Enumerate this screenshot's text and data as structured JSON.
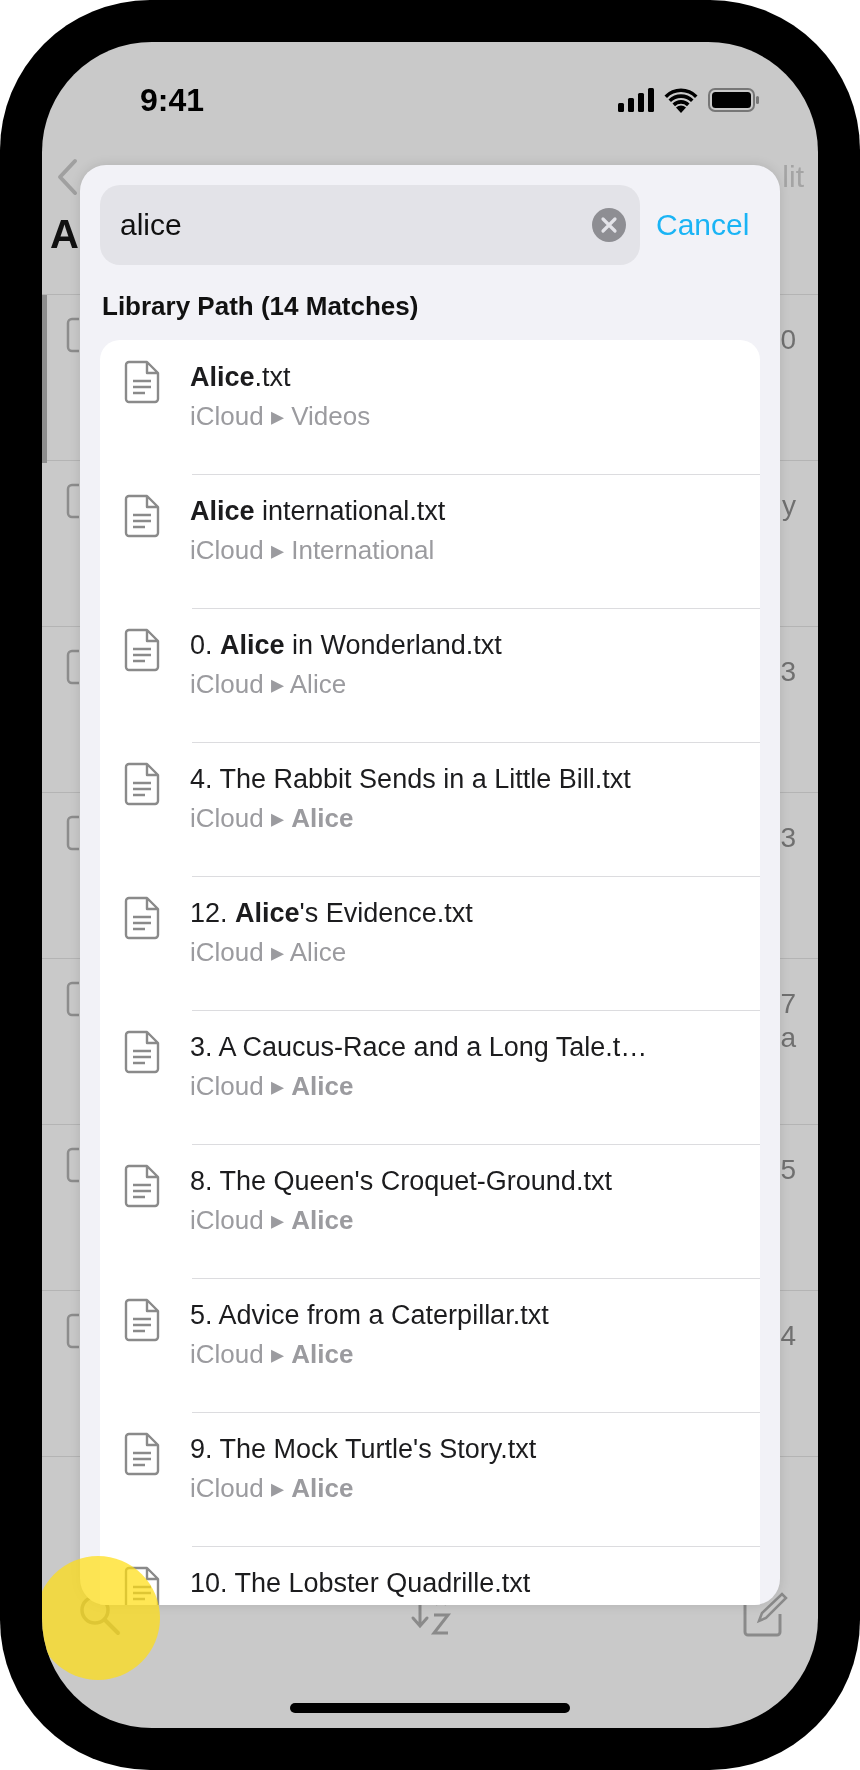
{
  "status_bar": {
    "time": "9:41"
  },
  "background": {
    "nav_fragment": "lit",
    "title_fragment": "A",
    "rows": [
      {
        "tail": [
          "0"
        ]
      },
      {
        "tail": [
          "y"
        ]
      },
      {
        "tail": [
          "3"
        ]
      },
      {
        "tail": [
          "3"
        ]
      },
      {
        "tail": [
          "7",
          "a"
        ]
      },
      {
        "tail": [
          "5"
        ]
      },
      {
        "tail": [
          "4"
        ]
      }
    ]
  },
  "search": {
    "value": "alice",
    "cancel": "Cancel"
  },
  "results": {
    "header": "Library Path (14 Matches)",
    "items": [
      {
        "title": "**Alice**.txt",
        "path": "iCloud ▸ Videos"
      },
      {
        "title": "**Alice** international.txt",
        "path": "iCloud ▸ International"
      },
      {
        "title": "0. **Alice** in Wonderland.txt",
        "path": "iCloud ▸ Alice"
      },
      {
        "title": "4. The Rabbit Sends in a Little Bill.txt",
        "path": "iCloud ▸ **Alice**"
      },
      {
        "title": "12. **Alice**'s Evidence.txt",
        "path": "iCloud ▸ Alice"
      },
      {
        "title": "3. A Caucus-Race and a Long Tale.t…",
        "path": "iCloud ▸ **Alice**"
      },
      {
        "title": "8. The Queen's Croquet-Ground.txt",
        "path": "iCloud ▸ **Alice**"
      },
      {
        "title": "5. Advice from a Caterpillar.txt",
        "path": "iCloud ▸ **Alice**"
      },
      {
        "title": "9. The Mock Turtle's Story.txt",
        "path": "iCloud ▸ **Alice**"
      },
      {
        "title": "10. The Lobster Quadrille.txt"
      }
    ]
  }
}
